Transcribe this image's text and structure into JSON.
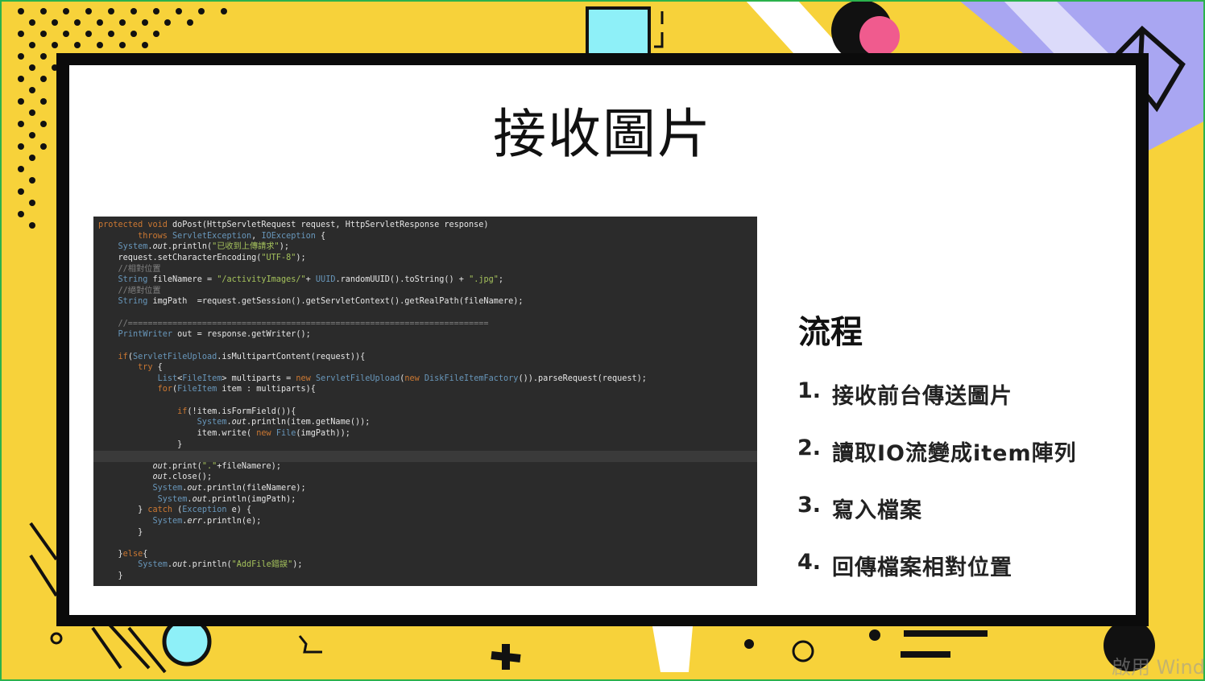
{
  "slide": {
    "title": "接收圖片",
    "flow_title": "流程",
    "steps": [
      {
        "num": "1.",
        "text": "接收前台傳送圖片"
      },
      {
        "num": "2.",
        "text": "讀取IO流變成item陣列"
      },
      {
        "num": "3.",
        "text": "寫入檔案"
      },
      {
        "num": "4.",
        "text": "回傳檔案相對位置"
      }
    ]
  },
  "code_lines": [
    "protected void doPost(HttpServletRequest request, HttpServletResponse response)",
    "        throws ServletException, IOException {",
    "    System.out.println(\"已收到上傳請求\");",
    "    request.setCharacterEncoding(\"UTF-8\");",
    "    //相對位置",
    "    String fileNamere = \"/activityImages/\"+ UUID.randomUUID().toString() + \".jpg\";",
    "    //絕對位置",
    "    String imgPath  =request.getSession().getServletContext().getRealPath(fileNamere);",
    "",
    "    //=========================================================================",
    "    PrintWriter out = response.getWriter();",
    "",
    "    if(ServletFileUpload.isMultipartContent(request)){",
    "        try {",
    "            List<FileItem> multiparts = new ServletFileUpload(new DiskFileItemFactory()).parseRequest(request);",
    "            for(FileItem item : multiparts){",
    "",
    "                if(!item.isFormField()){",
    "                    System.out.println(item.getName());",
    "                    item.write( new File(imgPath));",
    "                }",
    "            }",
    "           out.print(\".\"+fileNamere);",
    "           out.close();",
    "           System.out.println(fileNamere);",
    "            System.out.println(imgPath);",
    "        } catch (Exception e) {",
    "           System.err.println(e);",
    "        }",
    "",
    "    }else{",
    "        System.out.println(\"AddFile錯誤\");",
    "    }"
  ],
  "watermark": "啟用 Wind",
  "colors": {
    "background_yellow": "#f7d23a",
    "frame_black": "#0b0b0b",
    "code_background": "#2b2b2b",
    "accent_cyan": "#8ef0f8",
    "accent_pink": "#f05b8e",
    "accent_lavender": "#a9a6f2"
  }
}
